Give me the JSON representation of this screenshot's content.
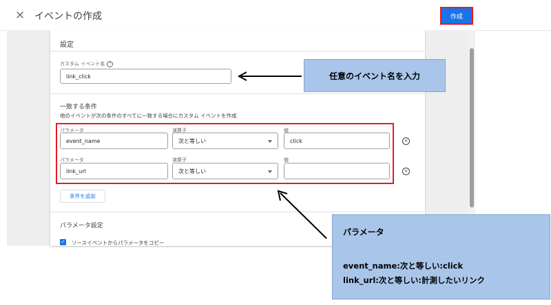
{
  "header": {
    "close_icon": "×",
    "title": "イベントの作成",
    "create_label": "作成"
  },
  "settings": {
    "section_title": "設定",
    "custom_event_label": "カスタム イベント名",
    "custom_event_value": "link_click"
  },
  "conditions": {
    "section_title": "一致する条件",
    "description": "他のイベントが次の条件のすべてに一致する場合にカスタム イベントを作成",
    "param_label": "パラメータ",
    "operator_label": "演算子",
    "value_label": "値",
    "rows": [
      {
        "parameter": "event_name",
        "operator": "次と等しい",
        "value": "click"
      },
      {
        "parameter": "link_url",
        "operator": "次と等しい",
        "value": ""
      }
    ],
    "add_label": "条件を追加"
  },
  "param_settings": {
    "section_title": "パラメータ設定",
    "copy_label": "ソースイベントからパラメータをコピー",
    "copy_checked": true
  },
  "callouts": {
    "event_name_note": "任意のイベント名を入力",
    "param_title": "パラメータ",
    "param_line1": "event_name:次と等しい:click",
    "param_line2": "link_url:次と等しい:計測したいリンク"
  },
  "colors": {
    "primary": "#1a73e8",
    "highlight": "#e21b22",
    "callout": "#a9c6ea"
  }
}
